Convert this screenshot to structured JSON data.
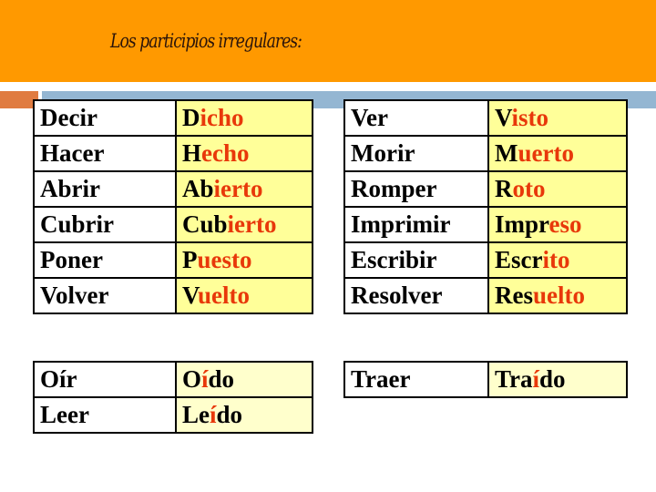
{
  "slide": {
    "title": "Los participios irregulares:",
    "colors": {
      "banner": "#FF9900",
      "accent_square": "#E07B40",
      "accent_bar": "#94B6D2",
      "participle_cell_top": "#FFFF99",
      "participle_cell_bottom": "#FFFFCC",
      "ending_highlight": "#E8380A"
    }
  },
  "tables": {
    "top_left": [
      {
        "infinitive": "Decir",
        "participle": "Dicho",
        "stem": "D",
        "ending": "icho"
      },
      {
        "infinitive": "Hacer",
        "participle": "Hecho",
        "stem": "H",
        "ending": "echo"
      },
      {
        "infinitive": "Abrir",
        "participle": "Abierto",
        "stem": "Ab",
        "ending": "ierto"
      },
      {
        "infinitive": "Cubrir",
        "participle": "Cubierto",
        "stem": "Cub",
        "ending": "ierto"
      },
      {
        "infinitive": "Poner",
        "participle": "Puesto",
        "stem": "P",
        "ending": "uesto"
      },
      {
        "infinitive": "Volver",
        "participle": "Vuelto",
        "stem": "V",
        "ending": "uelto"
      }
    ],
    "top_right": [
      {
        "infinitive": "Ver",
        "participle": "Visto",
        "stem": "V",
        "ending": "isto"
      },
      {
        "infinitive": "Morir",
        "participle": "Muerto",
        "stem": "M",
        "ending": "uerto"
      },
      {
        "infinitive": "Romper",
        "participle": "Roto",
        "stem": "R",
        "ending": "oto"
      },
      {
        "infinitive": "Imprimir",
        "participle": "Impreso",
        "stem": "Impr",
        "ending": "eso"
      },
      {
        "infinitive": "Escribir",
        "participle": "Escrito",
        "stem": "Escr",
        "ending": "ito"
      },
      {
        "infinitive": "Resolver",
        "participle": "Resuelto",
        "stem": "Res",
        "ending": "uelto"
      }
    ],
    "bottom_left": [
      {
        "infinitive": "Oír",
        "participle": "Oído",
        "stem": "O",
        "ending": "í",
        "rest": "do"
      },
      {
        "infinitive": "Leer",
        "participle": "Leído",
        "stem": "Le",
        "ending": "í",
        "rest": "do"
      }
    ],
    "bottom_right": [
      {
        "infinitive": "Traer",
        "participle": "Traído",
        "stem": "Tra",
        "ending": "í",
        "rest": "do"
      }
    ]
  }
}
